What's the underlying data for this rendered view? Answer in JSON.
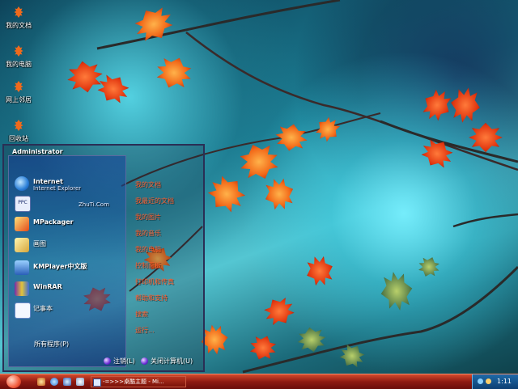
{
  "desktop": {
    "icons": [
      {
        "label": "我的文档",
        "icon": "maple-leaf-icon"
      },
      {
        "label": "我的电脑",
        "icon": "maple-leaf-icon"
      },
      {
        "label": "网上邻居",
        "icon": "maple-leaf-icon"
      },
      {
        "label": "回收站",
        "icon": "maple-leaf-icon"
      }
    ]
  },
  "start_menu": {
    "user": "Administrator",
    "programs": [
      {
        "name": "Internet",
        "sub": "Internet Explorer",
        "icon": "internet-explorer-icon"
      },
      {
        "name": "",
        "sub": "ZhuTi.Com",
        "icon": "ppc-icon"
      },
      {
        "name": "MPackager",
        "sub": "",
        "icon": "packager-icon"
      },
      {
        "name": "画图",
        "sub": "",
        "icon": "paint-icon"
      },
      {
        "name": "KMPlayer中文版",
        "sub": "",
        "icon": "kmplayer-icon"
      },
      {
        "name": "WinRAR",
        "sub": "",
        "icon": "winrar-icon"
      },
      {
        "name": "记事本",
        "sub": "",
        "icon": "notepad-icon"
      }
    ],
    "all_programs": "所有程序(P)",
    "right_links": [
      "我的文档",
      "我最近的文档",
      "我的图片",
      "我的音乐",
      "我的电脑",
      "控制面板",
      "打印机和传真",
      "帮助和支持",
      "搜索",
      "运行..."
    ],
    "logoff": "注销(L)",
    "shutdown": "关闭计算机(U)"
  },
  "taskbar": {
    "task_item": "-=>>>桌酷主题 - Mi...",
    "clock": "1:11"
  },
  "colors": {
    "taskbar": "#8e1a12",
    "tray": "#1e6aa8",
    "link": "#ff5a2a"
  }
}
